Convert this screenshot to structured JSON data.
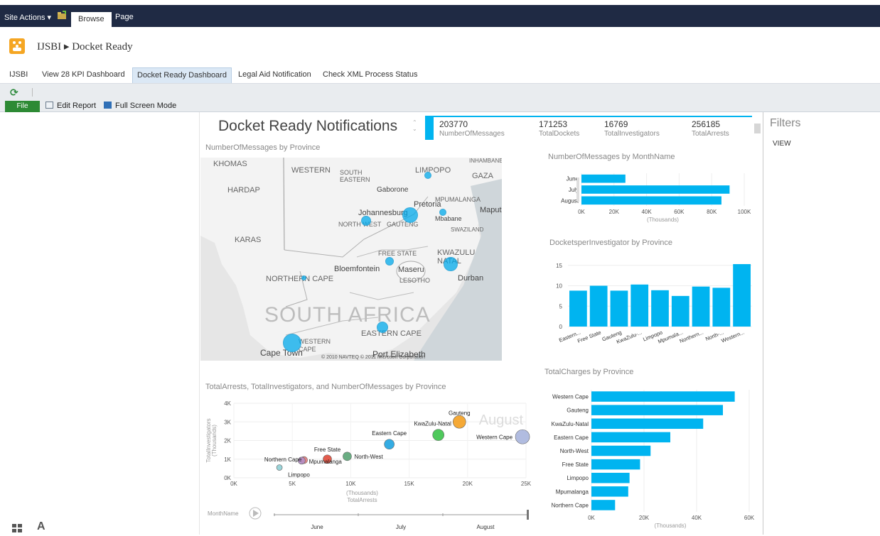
{
  "ribbon": {
    "site_actions": "Site Actions ▾",
    "browse_tab": "Browse",
    "page_tab": "Page"
  },
  "site": {
    "breadcrumb": "IJSBI ▸ Docket Ready"
  },
  "nav": {
    "tabs": [
      {
        "label": "IJSBI",
        "active": false
      },
      {
        "label": "View 28 KPI Dashboard",
        "active": false
      },
      {
        "label": "Docket Ready Dashboard",
        "active": true
      },
      {
        "label": "Legal Aid Notification",
        "active": false
      },
      {
        "label": "Check XML Process Status",
        "active": false
      }
    ]
  },
  "toolbar": {
    "file": "File",
    "edit_report": "Edit Report",
    "full_screen": "Full Screen Mode"
  },
  "report": {
    "title": "Docket Ready Notifications",
    "cards": [
      {
        "value": "203770",
        "label": "NumberOfMessages"
      },
      {
        "value": "171253",
        "label": "TotalDockets"
      },
      {
        "value": "16769",
        "label": "TotalInvestigators"
      },
      {
        "value": "256185",
        "label": "TotalArrests"
      }
    ]
  },
  "filters": {
    "title": "Filters",
    "view_label": "VIEW"
  },
  "map": {
    "title": "NumberOfMessages by Province",
    "labels": {
      "khomas": "KHOMAS",
      "western": "WESTERN",
      "southeastern": "SOUTH EASTERN",
      "limpopo": "LIMPOPO",
      "gaza": "GAZA",
      "inhambane": "INHAMBANE",
      "hardap": "HARDAP",
      "gaborone": "Gaborone",
      "mpumalanga": "MPUMALANGA",
      "pretoria": "Pretoria",
      "maputo": "Maputo",
      "johannesburg": "Johannesburg",
      "mbabane": "Mbabane",
      "northwest": "NORTH WEST",
      "gauteng": "GAUTENG",
      "swaziland": "SWAZILAND",
      "karas": "KARAS",
      "freestate": "FREE STATE",
      "kwazulu": "KWAZULU NATAL",
      "bloemfontein": "Bloemfontein",
      "maseru": "Maseru",
      "lesotho": "LESOTHO",
      "durban": "Durban",
      "northerncape": "NORTHERN CAPE",
      "country": "SOUTH AFRICA",
      "easterncape": "EASTERN CAPE",
      "westerncape": "WESTERN CAPE",
      "capetown": "Cape Town",
      "portelizabeth": "Port Elizabeth",
      "copyright": "© 2010 NAVTEQ © 2011 Microsoft Corporation"
    }
  },
  "icons": {
    "refresh": "refresh-icon",
    "folder": "folder-icon",
    "site_logo": "people-icon",
    "edit": "edit-report-icon",
    "fullscreen": "fullscreen-icon",
    "play": "play-icon"
  },
  "colors": {
    "accent": "#00b4f0",
    "ribbon": "#1f2a44",
    "file": "#2d8a34"
  },
  "chart_data": [
    {
      "id": "messages_by_month",
      "type": "bar",
      "orientation": "horizontal",
      "title": "NumberOfMessages by MonthName",
      "categories": [
        "June",
        "July",
        "August"
      ],
      "values": [
        27,
        91,
        86
      ],
      "xlim": [
        0,
        100
      ],
      "xticks": [
        "0K",
        "20K",
        "40K",
        "60K",
        "80K",
        "100K"
      ],
      "xunit": "(Thousands)"
    },
    {
      "id": "dockets_per_investigator",
      "type": "bar",
      "title": "DocketsperInvestigator by Province",
      "categories": [
        "Eastern...",
        "Free State",
        "Gauteng",
        "KwaZulu-...",
        "Limpopo",
        "Mpumala...",
        "Northern...",
        "North-...",
        "Western..."
      ],
      "values": [
        8.8,
        10.0,
        8.8,
        10.3,
        8.9,
        7.5,
        9.8,
        9.5,
        15.3
      ],
      "ylim": [
        0,
        16
      ],
      "yticks": [
        "0",
        "5",
        "10",
        "15"
      ]
    },
    {
      "id": "total_charges",
      "type": "bar",
      "orientation": "horizontal",
      "title": "TotalCharges by Province",
      "categories": [
        "Western Cape",
        "Gauteng",
        "KwaZulu-Natal",
        "Eastern Cape",
        "North-West",
        "Free State",
        "Limpopo",
        "Mpumalanga",
        "Northern Cape"
      ],
      "values": [
        54.5,
        50.0,
        42.5,
        30.0,
        22.5,
        18.5,
        14.5,
        14.0,
        9.0
      ],
      "xlim": [
        0,
        60
      ],
      "xticks": [
        "0K",
        "20K",
        "40K",
        "60K"
      ],
      "xunit": "(Thousands)"
    },
    {
      "id": "arrests_scatter",
      "type": "scatter",
      "title": "TotalArrests, TotalInvestigators, and NumberOfMessages by Province",
      "xlabel": "TotalArrests",
      "xunit": "(Thousands)",
      "ylabel": "TotalInvestigators",
      "yunit": "(Thousands)",
      "xlim": [
        0,
        25
      ],
      "ylim": [
        0,
        4
      ],
      "xticks": [
        "0K",
        "5K",
        "10K",
        "15K",
        "20K",
        "25K"
      ],
      "yticks": [
        "0K",
        "1K",
        "2K",
        "3K",
        "4K"
      ],
      "watermark": "August",
      "play_axis_label": "MonthName",
      "play_months": [
        "June",
        "July",
        "August"
      ],
      "points": [
        {
          "label": "Gauteng",
          "x": 19.3,
          "y": 3.0,
          "size": 9,
          "color": "#f4a020"
        },
        {
          "label": "KwaZulu-Natal",
          "x": 17.5,
          "y": 2.3,
          "size": 8,
          "color": "#3cc34a"
        },
        {
          "label": "Western Cape",
          "x": 24.7,
          "y": 2.2,
          "size": 10,
          "color": "#a9b5dd"
        },
        {
          "label": "Eastern Cape",
          "x": 13.3,
          "y": 1.8,
          "size": 7,
          "color": "#1ea3e0"
        },
        {
          "label": "North-West",
          "x": 9.7,
          "y": 1.15,
          "size": 6,
          "color": "#5aa575"
        },
        {
          "label": "Free State",
          "x": 8.0,
          "y": 1.0,
          "size": 6,
          "color": "#e04a3a"
        },
        {
          "label": "Mpumalanga",
          "x": 6.0,
          "y": 0.95,
          "size": 5,
          "color": "#e27a7a"
        },
        {
          "label": "Northern Cape",
          "x": 5.8,
          "y": 0.92,
          "size": 5,
          "color": "#b48ec6"
        },
        {
          "label": "Limpopo",
          "x": 3.9,
          "y": 0.55,
          "size": 4,
          "color": "#8fd0d6"
        }
      ]
    }
  ]
}
